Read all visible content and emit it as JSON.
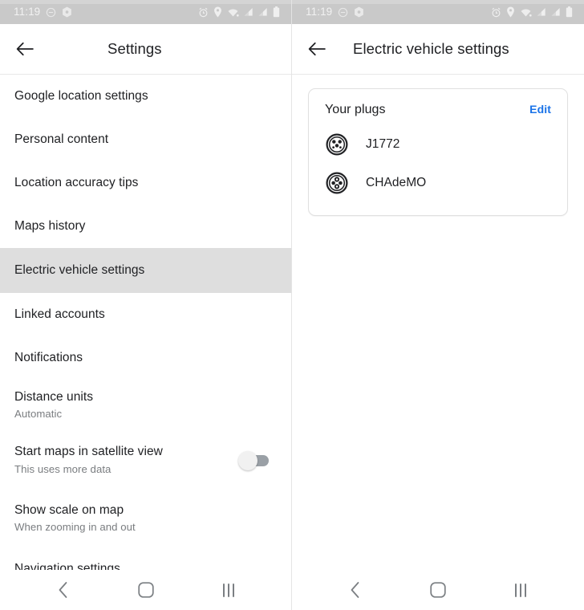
{
  "status_bar": {
    "time": "11:19",
    "left_icons": [
      "do-not-disturb-icon",
      "vpn-hexagon-icon"
    ],
    "right_icons": [
      "alarm-icon",
      "location-pin-icon",
      "wifi-icon",
      "signal-bars-icon",
      "signal-bars-2-icon",
      "battery-icon"
    ],
    "background_color": "#c9c9c9"
  },
  "left_panel": {
    "appbar": {
      "back_label": "Back",
      "title": "Settings"
    },
    "items": [
      {
        "title": "Google location settings",
        "subtitle": "",
        "control": "none",
        "selected": false
      },
      {
        "title": "Personal content",
        "subtitle": "",
        "control": "none",
        "selected": false
      },
      {
        "title": "Location accuracy tips",
        "subtitle": "",
        "control": "none",
        "selected": false
      },
      {
        "title": "Maps history",
        "subtitle": "",
        "control": "none",
        "selected": false
      },
      {
        "title": "Electric vehicle settings",
        "subtitle": "",
        "control": "none",
        "selected": true
      },
      {
        "title": "Linked accounts",
        "subtitle": "",
        "control": "none",
        "selected": false
      },
      {
        "title": "Notifications",
        "subtitle": "",
        "control": "none",
        "selected": false
      },
      {
        "title": "Distance units",
        "subtitle": "Automatic",
        "control": "none",
        "selected": false
      },
      {
        "title": "Start maps in satellite view",
        "subtitle": "This uses more data",
        "control": "toggle",
        "toggle_on": false,
        "selected": false
      },
      {
        "title": "Show scale on map",
        "subtitle": "When zooming in and out",
        "control": "none",
        "selected": false
      },
      {
        "title": "Navigation settings",
        "subtitle": "",
        "control": "none",
        "selected": false
      }
    ]
  },
  "right_panel": {
    "appbar": {
      "back_label": "Back",
      "title": "Electric vehicle settings"
    },
    "card": {
      "title": "Your plugs",
      "edit_label": "Edit",
      "edit_color": "#1a73e8",
      "plugs": [
        {
          "name": "J1772",
          "icon": "plug-j1772-icon"
        },
        {
          "name": "CHAdeMO",
          "icon": "plug-chademo-icon"
        }
      ]
    }
  },
  "nav_bar": {
    "back": "back-chevron-icon",
    "home": "home-square-icon",
    "recents": "recents-bars-icon"
  }
}
